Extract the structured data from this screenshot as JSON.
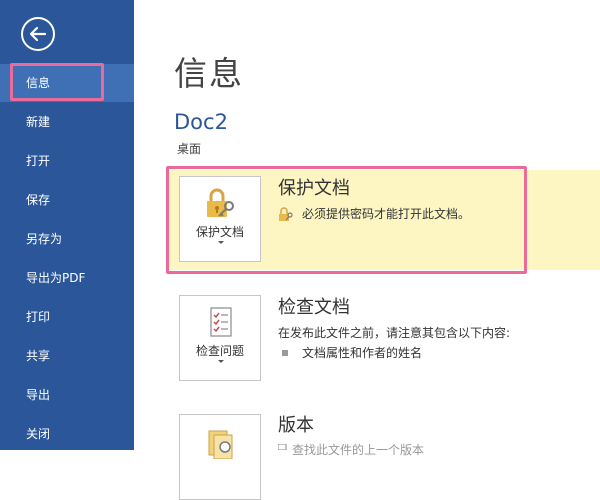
{
  "sidebar": {
    "items": [
      {
        "label": "信息"
      },
      {
        "label": "新建"
      },
      {
        "label": "打开"
      },
      {
        "label": "保存"
      },
      {
        "label": "另存为"
      },
      {
        "label": "导出为PDF"
      },
      {
        "label": "打印"
      },
      {
        "label": "共享"
      },
      {
        "label": "导出"
      },
      {
        "label": "关闭"
      }
    ],
    "selected_index": 0,
    "background_color": "#2b579a",
    "selected_color": "#3f6fb5"
  },
  "main": {
    "title": "信息",
    "document_name": "Doc2",
    "location": "桌面",
    "sections": [
      {
        "tile_label": "保护文档",
        "title": "保护文档",
        "description": "必须提供密码才能打开此文档。",
        "icon": "lock-key-icon"
      },
      {
        "tile_label": "检查问题",
        "title": "检查文档",
        "description": "在发布此文件之前，请注意其包含以下内容:",
        "bullet": "文档属性和作者的姓名",
        "icon": "checklist-icon"
      },
      {
        "tile_label": "",
        "title": "版本",
        "description_partial": "查找此文件的上一个版本",
        "icon": "versions-icon"
      }
    ]
  },
  "colors": {
    "highlight_border": "#ec6a9a",
    "protect_background": "#fdf6c3",
    "accent": "#2b579a"
  }
}
